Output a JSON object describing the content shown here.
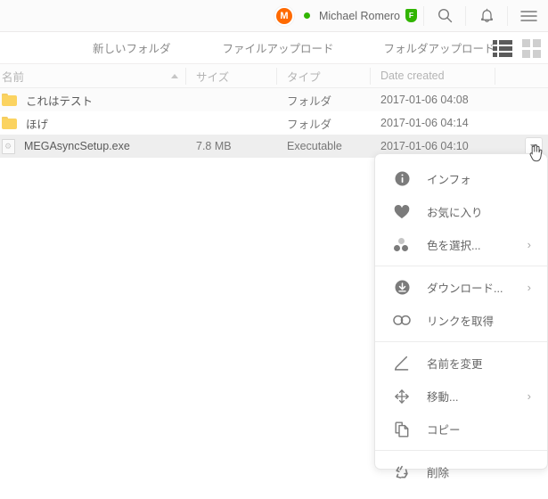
{
  "header": {
    "avatar_initial": "M",
    "username": "Michael Romero",
    "account_badge": "F",
    "online_status": "online",
    "search_icon": "search-icon",
    "notification_icon": "bell-icon",
    "menu_icon": "hamburger-icon",
    "accent_color": "#ff6a00",
    "status_color": "#31b500"
  },
  "toolbar": {
    "new_folder": "新しいフォルダ",
    "file_upload": "ファイルアップロード",
    "folder_upload": "フォルダアップロード",
    "list_view_icon": "list-view-icon",
    "grid_view_icon": "grid-view-icon"
  },
  "table": {
    "columns": [
      {
        "label": "名前",
        "sorted": "asc"
      },
      {
        "label": "サイズ"
      },
      {
        "label": "タイプ"
      },
      {
        "label": "Date created"
      }
    ],
    "rows": [
      {
        "icon": "folder-icon",
        "name": "これはテスト",
        "size": "",
        "type": "フォルダ",
        "date": "2017-01-06 04:08"
      },
      {
        "icon": "folder-icon",
        "name": "ほげ",
        "size": "",
        "type": "フォルダ",
        "date": "2017-01-06 04:14"
      },
      {
        "icon": "executable-file-icon",
        "name": "MEGAsyncSetup.exe",
        "size": "7.8 MB",
        "type": "Executable",
        "date": "2017-01-06 04:10"
      }
    ]
  },
  "context_menu": {
    "groups": [
      [
        {
          "icon": "info-icon",
          "label": "インフォ",
          "submenu": false
        },
        {
          "icon": "heart-icon",
          "label": "お気に入り",
          "submenu": false
        },
        {
          "icon": "color-dots-icon",
          "label": "色を選択...",
          "submenu": true
        }
      ],
      [
        {
          "icon": "download-icon",
          "label": "ダウンロード...",
          "submenu": true
        },
        {
          "icon": "link-icon",
          "label": "リンクを取得",
          "submenu": false
        }
      ],
      [
        {
          "icon": "pencil-icon",
          "label": "名前を変更",
          "submenu": false
        },
        {
          "icon": "move-arrows-icon",
          "label": "移動...",
          "submenu": true
        },
        {
          "icon": "copy-icon",
          "label": "コピー",
          "submenu": false
        }
      ],
      [
        {
          "icon": "recycle-icon",
          "label": "削除",
          "submenu": false
        }
      ]
    ],
    "submenu_chevron": "›"
  }
}
